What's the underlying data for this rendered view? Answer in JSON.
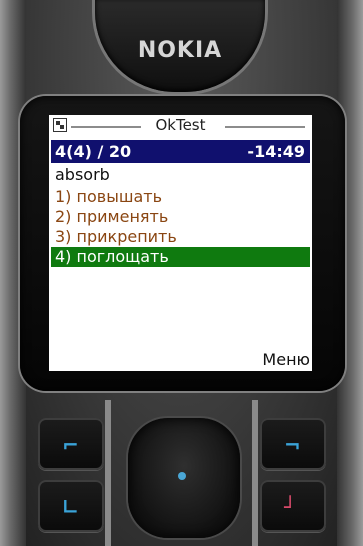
{
  "device": {
    "brand": "NOKIA"
  },
  "app": {
    "title": "OkTest",
    "status_left": "4(4) / 20",
    "status_right": "-14:49",
    "word": "absorb",
    "options": [
      {
        "label": "1) повышать",
        "selected": false
      },
      {
        "label": "2) применять",
        "selected": false
      },
      {
        "label": "3) прикрепить",
        "selected": false
      },
      {
        "label": "4) поглощать",
        "selected": true
      }
    ],
    "softkey_right": "Меню"
  },
  "colors": {
    "status_bg": "#10106e",
    "selected_bg": "#0f7a0f",
    "option_text": "#8a4612",
    "nav_dot": "#4aa7d6"
  },
  "icons": [
    "app-menu-icon",
    "call-key-icon",
    "end-key-icon",
    "softkey-left-icon",
    "softkey-right-icon"
  ]
}
